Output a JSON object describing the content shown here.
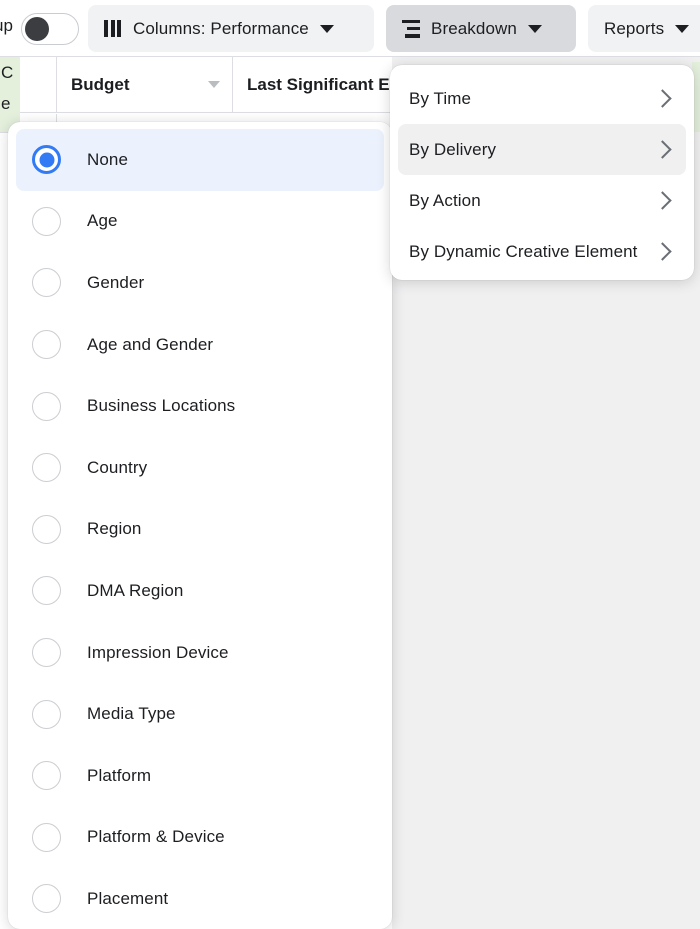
{
  "toolbar": {
    "group_label": "up",
    "toggle": {
      "name": "group-toggle",
      "state": "off"
    },
    "columns_button": {
      "label": "Columns: Performance",
      "icon": "columns-icon",
      "caret": "chevron-down-icon"
    },
    "breakdown_button": {
      "label": "Breakdown",
      "icon": "breakdown-icon",
      "caret": "chevron-down-icon",
      "state": "active"
    },
    "reports_button": {
      "label": "Reports",
      "caret": "chevron-down-icon"
    }
  },
  "table": {
    "headers": [
      {
        "label": "Budget",
        "sort_icon": "sort-caret-icon"
      },
      {
        "label": "Last Significant E",
        "sort_icon": ""
      }
    ],
    "partial_cells": {
      "left_line_1": "C",
      "left_line_2": "e"
    }
  },
  "breakdown_menu": {
    "items": [
      {
        "label": "By Time",
        "chevron": "chevron-right-icon",
        "hover": false
      },
      {
        "label": "By Delivery",
        "chevron": "chevron-right-icon",
        "hover": true
      },
      {
        "label": "By Action",
        "chevron": "chevron-right-icon",
        "hover": false
      },
      {
        "label": "By Dynamic Creative Element",
        "chevron": "chevron-right-icon",
        "hover": false
      }
    ]
  },
  "breakdown_options": {
    "selected": "None",
    "items": [
      {
        "label": "None",
        "selected": true
      },
      {
        "label": "Age",
        "selected": false
      },
      {
        "label": "Gender",
        "selected": false
      },
      {
        "label": "Age and Gender",
        "selected": false
      },
      {
        "label": "Business Locations",
        "selected": false
      },
      {
        "label": "Country",
        "selected": false
      },
      {
        "label": "Region",
        "selected": false
      },
      {
        "label": "DMA Region",
        "selected": false
      },
      {
        "label": "Impression Device",
        "selected": false
      },
      {
        "label": "Media Type",
        "selected": false
      },
      {
        "label": "Platform",
        "selected": false
      },
      {
        "label": "Platform & Device",
        "selected": false
      },
      {
        "label": "Placement",
        "selected": false
      }
    ]
  },
  "colors": {
    "accent_blue": "#337bf5",
    "selected_row_bg": "#ebf2fe",
    "button_bg": "#f1f2f3",
    "button_active_bg": "#d8dadd",
    "green_cell": "#e4efdc",
    "text": "#1c1e21"
  }
}
